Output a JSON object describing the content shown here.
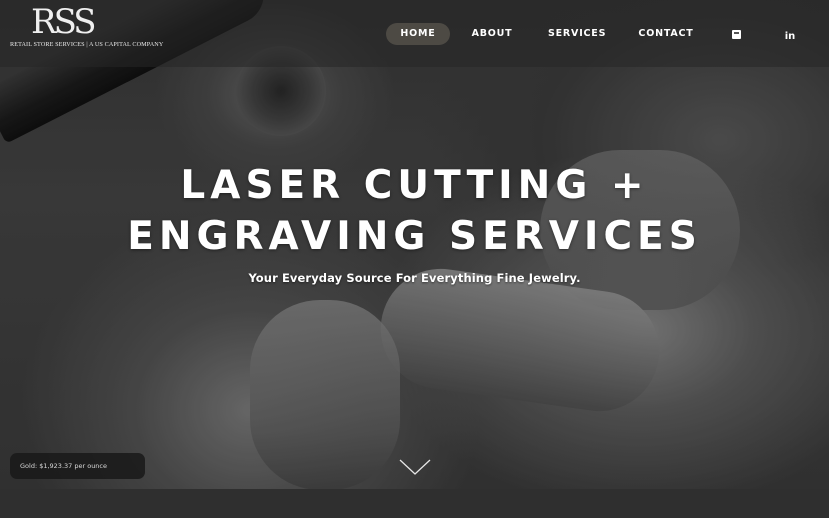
{
  "logo": {
    "mark": "RSS",
    "tagline": "RETAIL STORE SERVICES | A US CAPITAL COMPANY"
  },
  "nav": {
    "items": [
      {
        "label": "HOME",
        "active": true
      },
      {
        "label": "ABOUT",
        "active": false
      },
      {
        "label": "SERVICES",
        "active": false
      },
      {
        "label": "CONTACT",
        "active": false
      }
    ],
    "icons": [
      {
        "name": "contact-card-icon"
      },
      {
        "name": "linkedin-icon",
        "glyph": "in"
      }
    ]
  },
  "hero": {
    "title_line1": "LASER CUTTING +",
    "title_line2": "ENGRAVING SERVICES",
    "subtitle": "Your Everyday Source For Everything Fine Jewelry."
  },
  "notice": {
    "text": "Gold: $1,923.37 per ounce"
  },
  "colors": {
    "header_bg": "#262626",
    "nav_active_bg": "#5a564e",
    "text": "#ffffff",
    "footer_band": "#2f2f2f"
  }
}
